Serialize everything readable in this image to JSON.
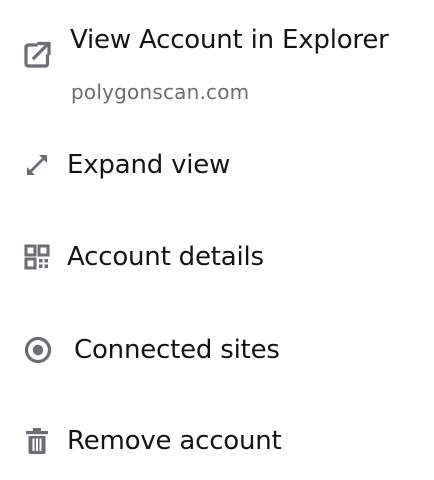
{
  "colors": {
    "icon": "#6a6d73",
    "text": "#141414",
    "subtext": "#6a6d73",
    "background": "#ffffff"
  },
  "menu": {
    "items": [
      {
        "label": "View Account in Explorer",
        "sublabel": "polygonscan.com",
        "icon": "external-link-icon"
      },
      {
        "label": "Expand view",
        "icon": "expand-arrows-icon"
      },
      {
        "label": "Account details",
        "icon": "qr-code-icon"
      },
      {
        "label": "Connected sites",
        "icon": "radio-dot-icon"
      },
      {
        "label": "Remove account",
        "icon": "trash-icon"
      }
    ]
  }
}
